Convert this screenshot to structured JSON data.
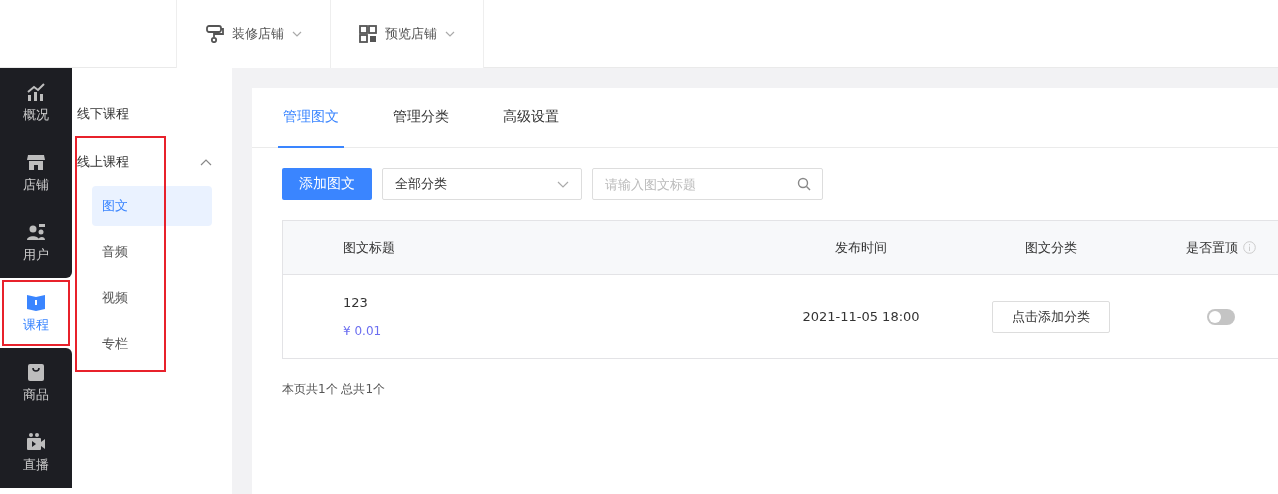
{
  "header": {
    "menus": [
      {
        "kind": "decorate",
        "label": "装修店铺"
      },
      {
        "kind": "preview",
        "label": "预览店铺"
      }
    ]
  },
  "nav_rail": {
    "items": [
      {
        "kind": "overview",
        "label": "概况",
        "selected": false,
        "highlighted": false
      },
      {
        "kind": "store",
        "label": "店铺",
        "selected": false,
        "highlighted": false
      },
      {
        "kind": "users",
        "label": "用户",
        "selected": false,
        "highlighted": false
      },
      {
        "kind": "course",
        "label": "课程",
        "selected": true,
        "highlighted": true
      },
      {
        "kind": "goods",
        "label": "商品",
        "selected": false,
        "highlighted": false
      },
      {
        "kind": "live",
        "label": "直播",
        "selected": false,
        "highlighted": false
      }
    ]
  },
  "sub_menu": {
    "groups": [
      {
        "label": "线下课程",
        "expanded": false,
        "highlighted": false
      },
      {
        "label": "线上课程",
        "expanded": true,
        "highlighted": true,
        "children": [
          {
            "label": "图文",
            "selected": true
          },
          {
            "label": "音频",
            "selected": false
          },
          {
            "label": "视频",
            "selected": false
          },
          {
            "label": "专栏",
            "selected": false
          }
        ]
      }
    ]
  },
  "tabs": [
    {
      "label": "管理图文",
      "selected": true
    },
    {
      "label": "管理分类",
      "selected": false
    },
    {
      "label": "高级设置",
      "selected": false
    }
  ],
  "toolbar": {
    "add_button": "添加图文",
    "category_select": {
      "value": "全部分类"
    },
    "search": {
      "placeholder": "请输入图文标题"
    }
  },
  "table": {
    "columns": [
      {
        "label": "图文标题"
      },
      {
        "label": "发布时间"
      },
      {
        "label": "图文分类"
      },
      {
        "label": "是否置顶",
        "info": true
      }
    ],
    "rows": [
      {
        "title": "123",
        "price": "¥ 0.01",
        "published": "2021-11-05 18:00",
        "category_button": "点击添加分类",
        "pinned": false
      }
    ]
  },
  "pagination_summary": "本页共1个 总共1个"
}
